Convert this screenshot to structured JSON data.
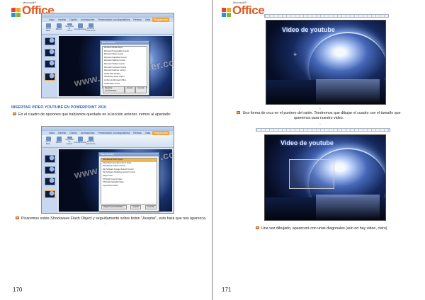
{
  "brand": {
    "microsoft": "Microsoft®",
    "office": "Office"
  },
  "left_page": {
    "number": "170",
    "section_title": "INSERTAR VIDEO YOUTUBE EN POWERPOINT 2010",
    "caption_1": "En el cuadro de opciones que habíamos quedado en la lección anterior, iremos al apartado:",
    "caption_2": "Picaremos sobre Shockwave Flash Object y seguidamente sobre botón \"Aceptar\", esto hará que nos aparezca.",
    "caption_2_tail": "-",
    "screenshot_1": {
      "tabs": [
        "Inicio",
        "Insertar",
        "Diseño",
        "Animaciones",
        "Presentación con diapositivas",
        "Revisar",
        "Vista",
        "Programador"
      ],
      "tools": [
        "Visual Basic",
        "Macros",
        "Seguridad de macros",
        "Complementos",
        "Panel de documento"
      ],
      "dialog_title": "Más controles",
      "dialog_items": [
        "Windows Media Player",
        "Microsoft ProgressBar Control",
        "Microsoft Slider Control",
        "Microsoft StatusBar Control",
        "Microsoft TabStrip Control",
        "Microsoft Toolbar Control",
        "Microsoft TreeView Control",
        "Microsoft UpDown Control",
        "Adobe PDF Reader",
        "Shockwave Flash Object",
        "Archivo de Microsoft Office",
        "Audio/Video Codec"
      ],
      "dialog_buttons": [
        "Registrar personalizado...",
        "Aceptar",
        "Cancelar"
      ],
      "watermark": "www.desaprender.com"
    },
    "screenshot_2": {
      "tabs": [
        "Inicio",
        "Insertar",
        "Diseño",
        "Animaciones",
        "Presentación con diapositivas",
        "Revisar",
        "Vista",
        "Programador"
      ],
      "tools": [
        "Visual Basic",
        "Macros",
        "Seguridad de macros",
        "Complementos",
        "Panel de documento"
      ],
      "dialog_title": "Más controles",
      "dialog_items": [
        "Shockwave Flash Object",
        "SharePoint OpenDocuments Class",
        "Shockwave ActiveX Control",
        "Sky Software Preview ActiveX Control",
        "Sky Software ShellView ActiveX Control",
        "Skype Color",
        "STSUpld.CopyCtl Class",
        "STSUpld.UploadCtl Class",
        "SysColorCtrl Class"
      ],
      "dialog_buttons": [
        "Registrar personalizado...",
        "Aceptar",
        "Cancelar"
      ],
      "watermark": "www.desaprender.com"
    }
  },
  "right_page": {
    "number": "171",
    "caption_1": "Una forma de cruz en el puntero del ratón. Tendremos que dibujar el cuadro con el tamaño que queremos para nuestro video.",
    "caption_2": "Una vez dibujado, aparecerá con unas diagonales (aún no hay video, claro)",
    "slide_1_title": "Video de youtube",
    "slide_2_title": "Video de youtube",
    "crosshair": "+",
    "dash_mark": "-"
  }
}
